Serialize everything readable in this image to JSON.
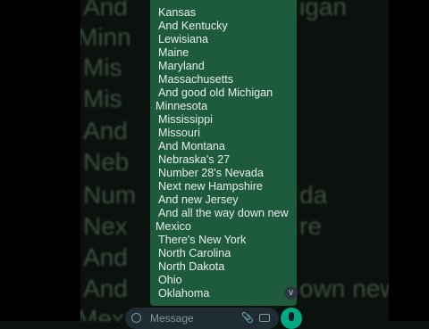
{
  "message": {
    "lines": [
      "Kansas",
      "And Kentucky",
      "Lewisiana",
      "Maine",
      "Maryland",
      "Massachusetts",
      "And good old Michigan",
      "Minnesota",
      "Mississippi",
      "Missouri",
      "And Montana",
      "Nebraska's 27",
      "Number 28's Nevada",
      "Next new Hampshire",
      "And new Jersey",
      "And all the way down new",
      "Mexico",
      "There's New York",
      "North Carolina",
      "North Dakota",
      "Ohio",
      "Oklahoma"
    ]
  },
  "background_echo": {
    "lines": [
      "And",
      "Minn",
      "Mis",
      "Mis",
      "And",
      "Neb",
      "Num",
      "Nex",
      "And",
      "And",
      "Mex"
    ],
    "right_fragments": [
      "igan",
      "da",
      "re",
      "own new"
    ]
  },
  "compose": {
    "placeholder": "Message"
  },
  "icons": {
    "emoji": "emoji-icon",
    "attach": "paperclip-icon",
    "camera": "camera-icon",
    "mic": "microphone-icon",
    "scroll": "chevron-double-down-icon"
  },
  "colors": {
    "bubble": "#1e5b3d",
    "text": "#e9edef",
    "accent": "#00a884"
  }
}
